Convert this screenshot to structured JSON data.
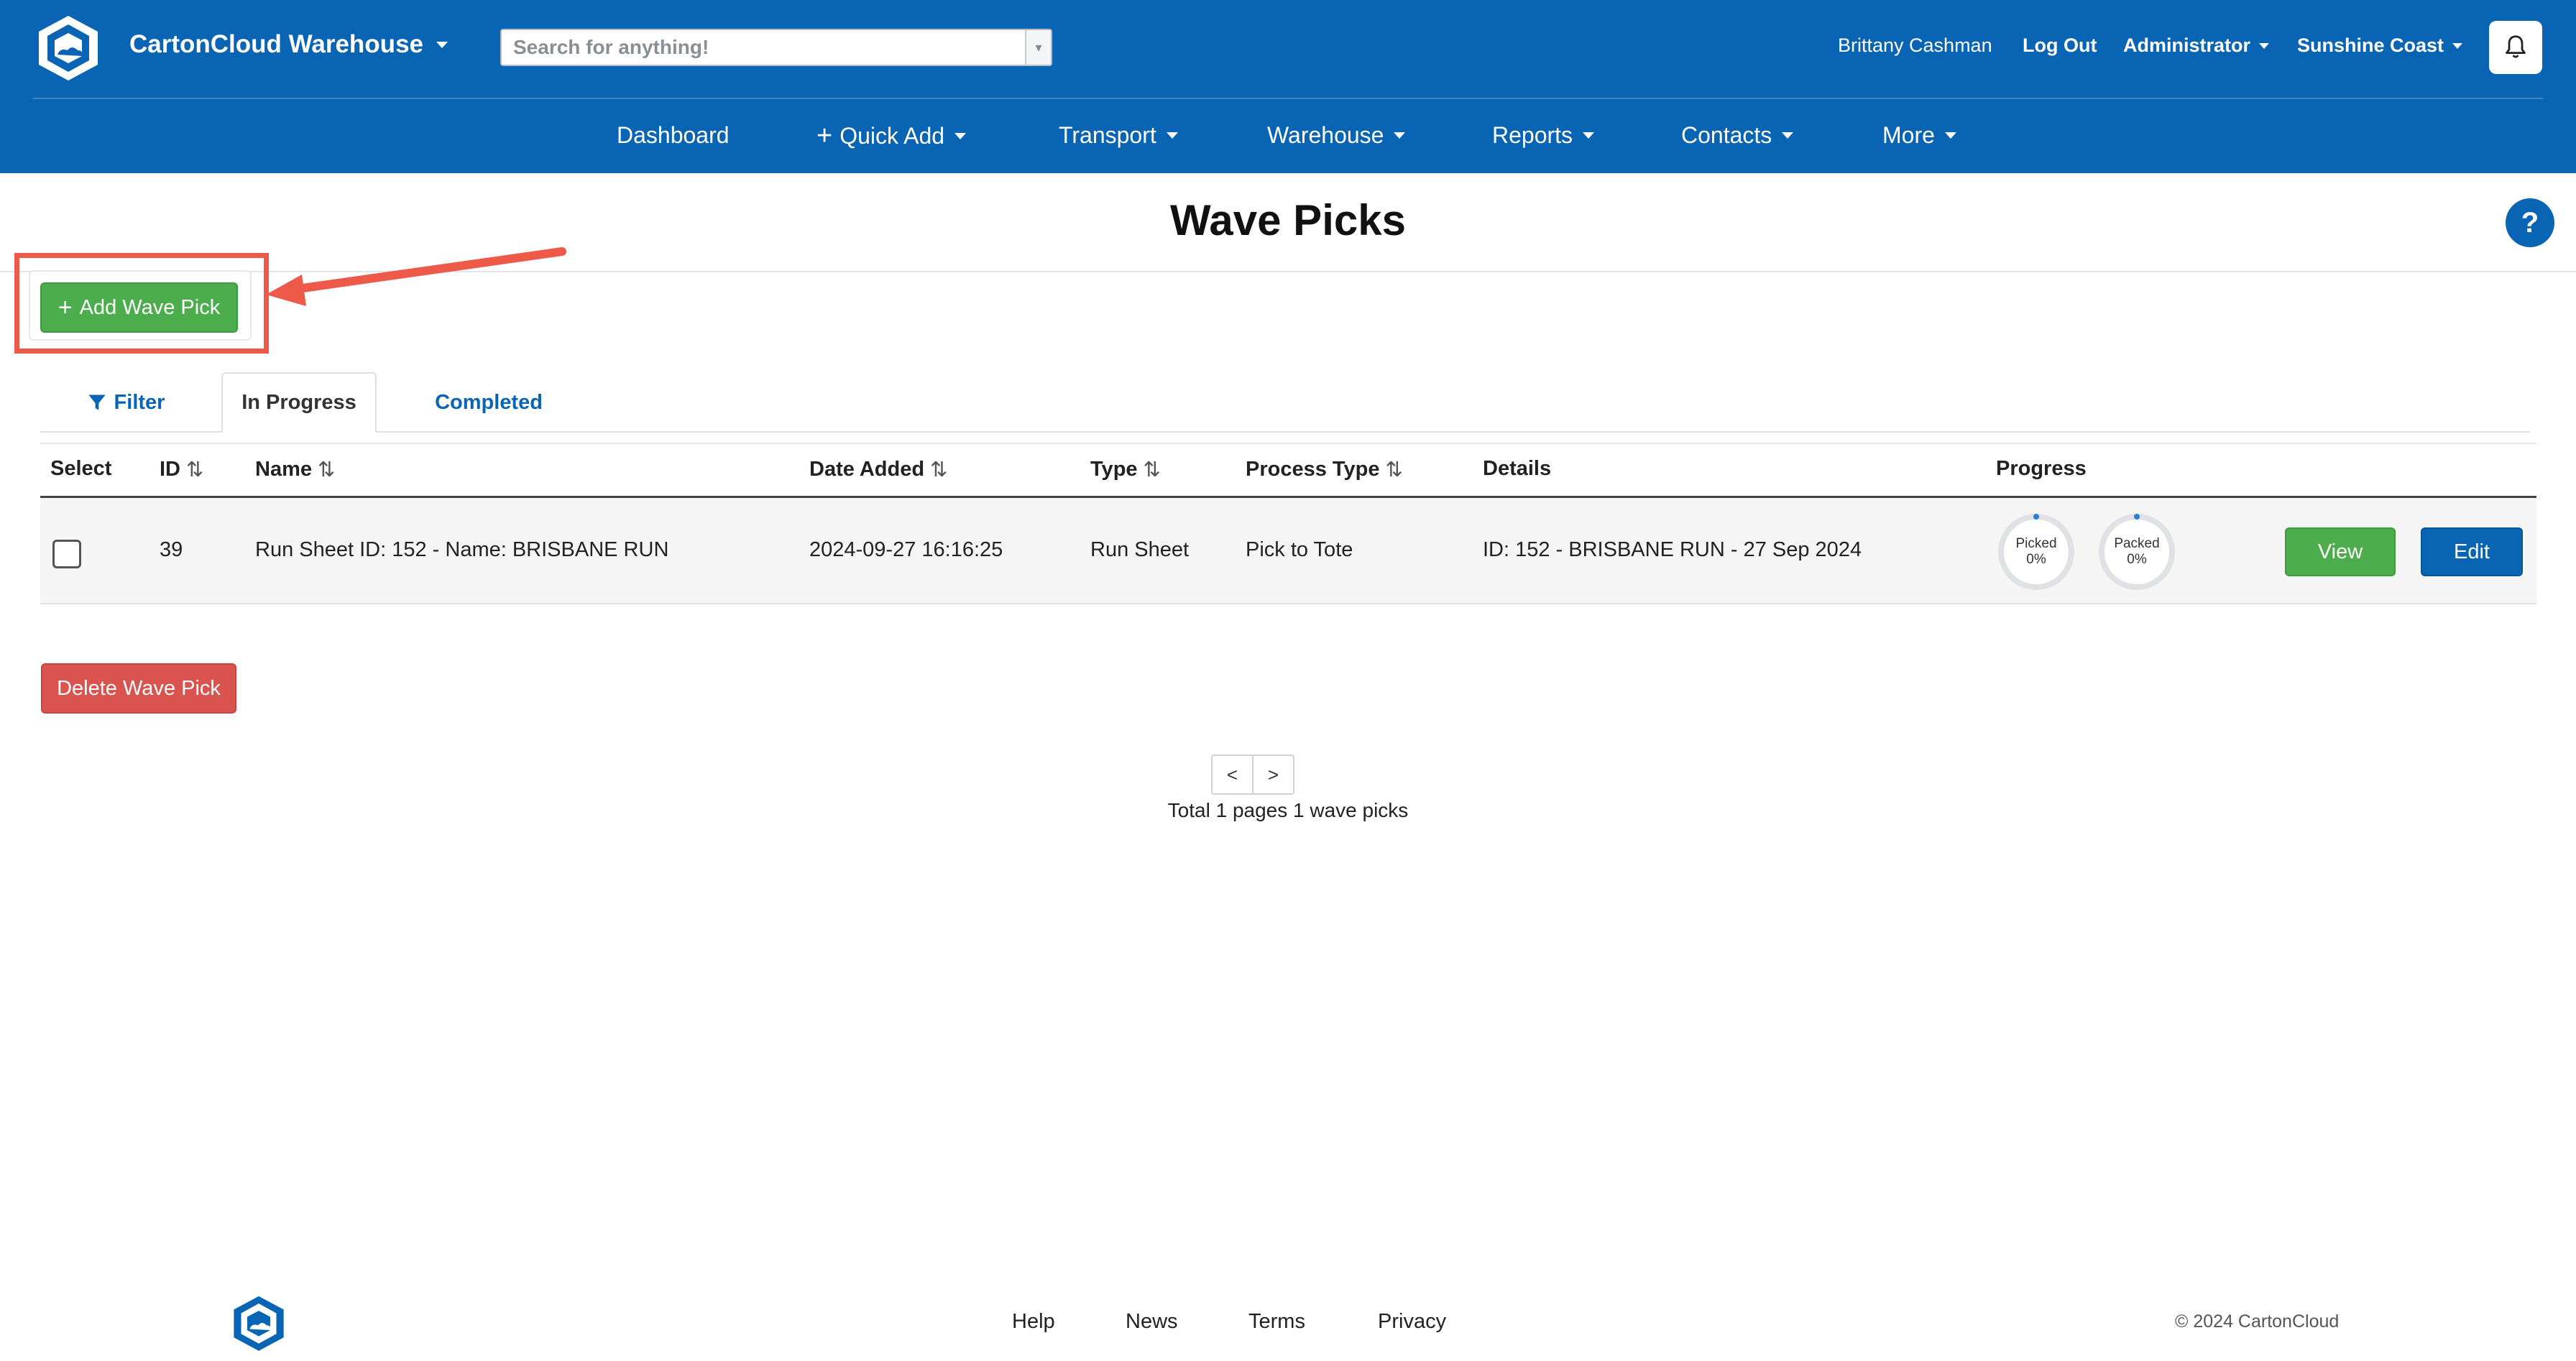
{
  "header": {
    "app_name": "CartonCloud Warehouse",
    "search_placeholder": "Search for anything!",
    "user_name": "Brittany Cashman",
    "logout_label": "Log Out",
    "role_label": "Administrator",
    "location_label": "Sunshine Coast"
  },
  "nav": {
    "dashboard": "Dashboard",
    "quick_add": "Quick Add",
    "transport": "Transport",
    "warehouse": "Warehouse",
    "reports": "Reports",
    "contacts": "Contacts",
    "more": "More"
  },
  "page": {
    "title": "Wave Picks",
    "help_label": "?",
    "add_button_label": "Add Wave Pick"
  },
  "tabs": {
    "filter": "Filter",
    "in_progress": "In Progress",
    "completed": "Completed"
  },
  "table": {
    "headers": {
      "select": "Select",
      "id": "ID",
      "name": "Name",
      "date_added": "Date Added",
      "type": "Type",
      "process_type": "Process Type",
      "details": "Details",
      "progress": "Progress"
    },
    "rows": [
      {
        "id": "39",
        "name": "Run Sheet ID: 152 - Name: BRISBANE RUN",
        "date_added": "2024-09-27 16:16:25",
        "type": "Run Sheet",
        "process_type": "Pick to Tote",
        "details": "ID: 152 - BRISBANE RUN - 27 Sep 2024",
        "picked_label": "Picked",
        "picked_pct": "0%",
        "packed_label": "Packed",
        "packed_pct": "0%",
        "view_label": "View",
        "edit_label": "Edit"
      }
    ]
  },
  "actions": {
    "delete_label": "Delete Wave Pick"
  },
  "pagination": {
    "prev": "<",
    "next": ">",
    "summary": "Total 1 pages 1 wave picks"
  },
  "footer": {
    "help": "Help",
    "news": "News",
    "terms": "Terms",
    "privacy": "Privacy",
    "copyright": "© 2024 CartonCloud"
  },
  "colors": {
    "brand_blue": "#0a64b4",
    "success_green": "#4cad4c",
    "danger_red": "#d9534f",
    "annotation_red": "#ee5a4a"
  }
}
